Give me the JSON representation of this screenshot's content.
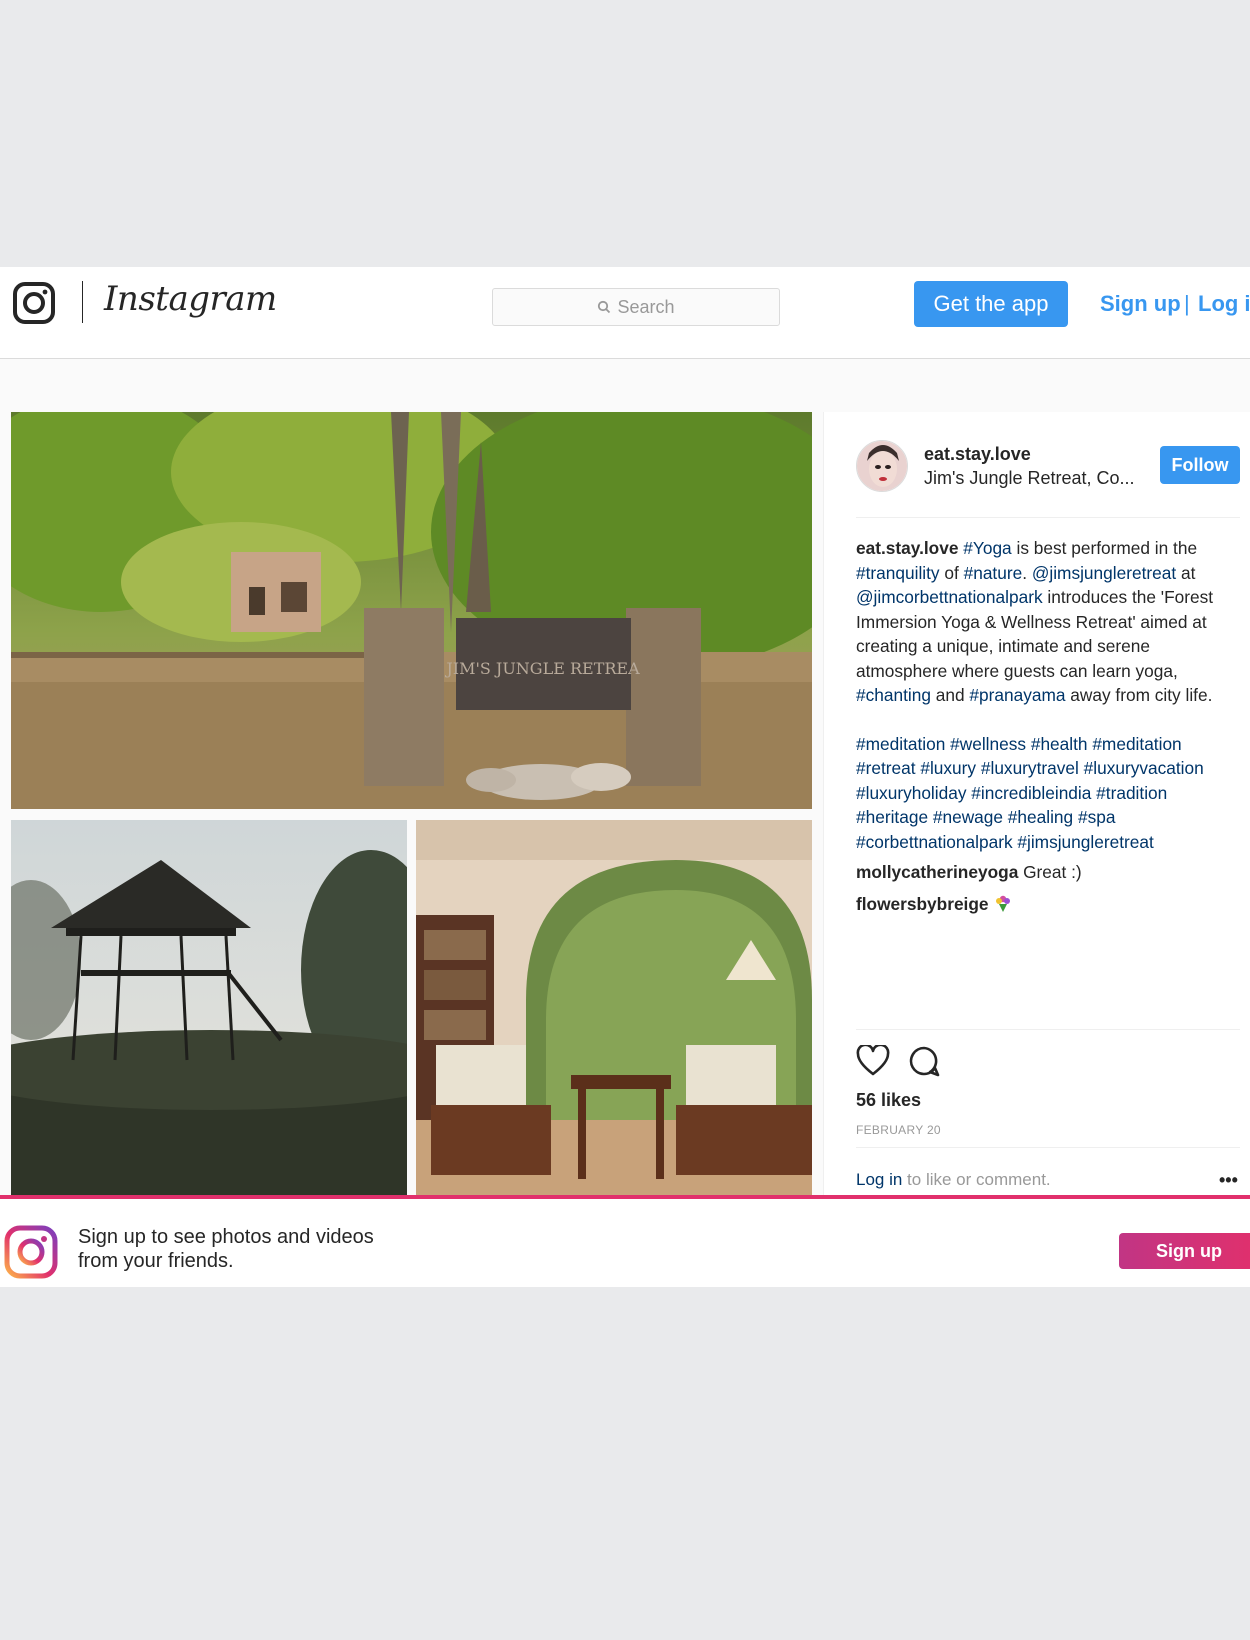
{
  "header": {
    "brand": "Instagram",
    "search_placeholder": "Search",
    "get_app": "Get the app",
    "sign_up": "Sign up",
    "separator": "|",
    "log_in": "Log in"
  },
  "post": {
    "username": "eat.stay.love",
    "location": "Jim's Jungle Retreat, Co...",
    "follow": "Follow",
    "photos": [
      {
        "alt": "JIM'S JUNGLE RETREAT wooden sign in a forest clearing"
      },
      {
        "alt": "Thatched watchtower on a hilltop at sunrise"
      },
      {
        "alt": "Veranda with wooden armchairs and a small table under an arch"
      }
    ],
    "sign_text": "JIM'S JUNGLE RETREA",
    "caption": {
      "username": "eat.stay.love",
      "parts": [
        {
          "t": " "
        },
        {
          "t": "#Yoga",
          "link": true
        },
        {
          "t": " is best performed in the "
        },
        {
          "t": "#tranquility",
          "link": true
        },
        {
          "t": " of "
        },
        {
          "t": "#nature",
          "link": true
        },
        {
          "t": ". "
        },
        {
          "t": "@jimsjungleretreat",
          "link": true
        },
        {
          "t": " at "
        },
        {
          "t": "@jimcorbettnationalpark",
          "link": true
        },
        {
          "t": " introduces the 'Forest Immersion Yoga & Wellness Retreat' aimed at creating a unique, intimate and serene atmosphere where guests can learn yoga, "
        },
        {
          "t": "#chanting",
          "link": true
        },
        {
          "t": " and "
        },
        {
          "t": "#pranayama",
          "link": true
        },
        {
          "t": " away from city life."
        }
      ],
      "hashtags": "#meditation #wellness #health #meditation #retreat #luxury #luxurytravel #luxuryvacation #luxuryholiday #incredibleindia #tradition #heritage #newage #healing #spa #corbettnationalpark #jimsjungleretreat"
    },
    "comments": [
      {
        "username": "mollycatherineyoga",
        "text": " Great :)"
      },
      {
        "username": "flowersbybreige",
        "text": " ",
        "emoji": "bouquet-icon"
      }
    ],
    "likes": "56 likes",
    "date": "FEBRUARY 20",
    "login_link": "Log in",
    "login_rest": " to like or comment.",
    "more": "•••"
  },
  "banner": {
    "text": "Sign up to see photos and videos from your friends.",
    "sign_up": "Sign up"
  },
  "colors": {
    "accent": "#3897f0",
    "link": "#003569",
    "banner_gradient": [
      "#c13584",
      "#e1306c"
    ]
  }
}
